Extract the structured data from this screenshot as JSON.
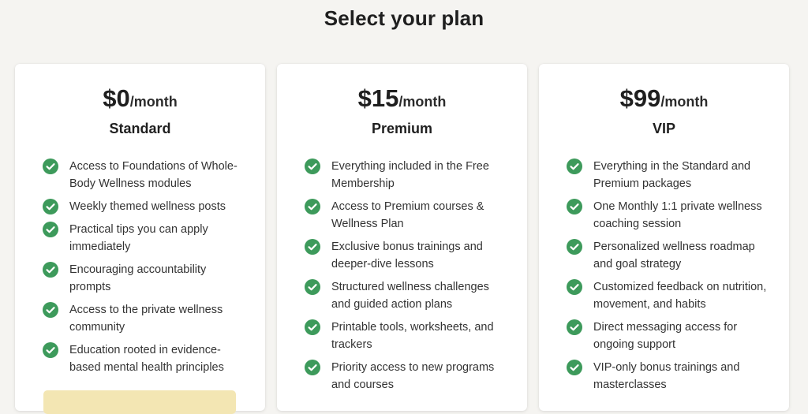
{
  "page": {
    "title": "Select your plan"
  },
  "colors": {
    "background": "#f5f4f1",
    "card": "#ffffff",
    "check": "#3d9a5b",
    "cta": "#f3e6b3"
  },
  "plans": [
    {
      "price": "$0",
      "period": "/month",
      "name": "Standard",
      "features": [
        "Access to Foundations of Whole-Body Wellness modules",
        "Weekly themed wellness posts",
        "Practical tips you can apply immediately",
        "Encouraging accountability prompts",
        "Access to the private wellness community",
        "Education rooted in evidence-based mental health principles"
      ]
    },
    {
      "price": "$15",
      "period": "/month",
      "name": "Premium",
      "features": [
        "Everything included in the Free Membership",
        "Access to Premium courses & Wellness Plan",
        "Exclusive bonus trainings and deeper-dive lessons",
        "Structured wellness challenges and guided action plans",
        "Printable tools, worksheets, and trackers",
        "Priority access to new programs and courses"
      ]
    },
    {
      "price": "$99",
      "period": "/month",
      "name": "VIP",
      "features": [
        "Everything in the Standard and Premium packages",
        "One Monthly 1:1 private wellness coaching session",
        "Personalized wellness roadmap and goal strategy",
        "Customized feedback on nutrition, movement, and habits",
        "Direct messaging access for ongoing support",
        "VIP-only bonus trainings and masterclasses"
      ]
    }
  ]
}
